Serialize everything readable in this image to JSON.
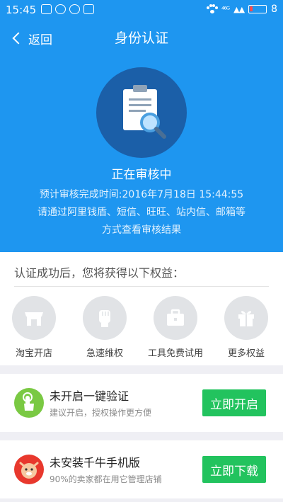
{
  "status_bar": {
    "time": "15:45",
    "battery": "8",
    "signal": "⁴⁶ᴳ"
  },
  "nav": {
    "back_label": "返回",
    "title": "身份认证"
  },
  "hero": {
    "status": "正在审核中",
    "lines": [
      "预计审核完成时间:2016年7月18日 15:44:55",
      "请通过阿里钱盾、短信、旺旺、站内信、邮箱等",
      "方式查看审核结果"
    ]
  },
  "benefits": {
    "title": "认证成功后，您将获得以下权益：",
    "items": [
      {
        "label": "淘宝开店",
        "icon": "store-icon"
      },
      {
        "label": "急速维权",
        "icon": "fist-icon"
      },
      {
        "label": "工具免费试用",
        "icon": "toolbox-icon"
      },
      {
        "label": "更多权益",
        "icon": "gift-icon"
      }
    ]
  },
  "cards": [
    {
      "title": "未开启一键验证",
      "subtitle": "建议开启，授权操作更方便",
      "button": "立即开启",
      "icon": "tap-finger-icon",
      "icon_color": "#7ac943"
    },
    {
      "title": "未安装千牛手机版",
      "subtitle": "90%的卖家都在用它管理店铺",
      "button": "立即下载",
      "icon": "qianniu-logo-icon",
      "icon_color": "#e8382d"
    }
  ],
  "colors": {
    "header_blue": "#1e96f0",
    "accent_green": "#22c35e"
  }
}
